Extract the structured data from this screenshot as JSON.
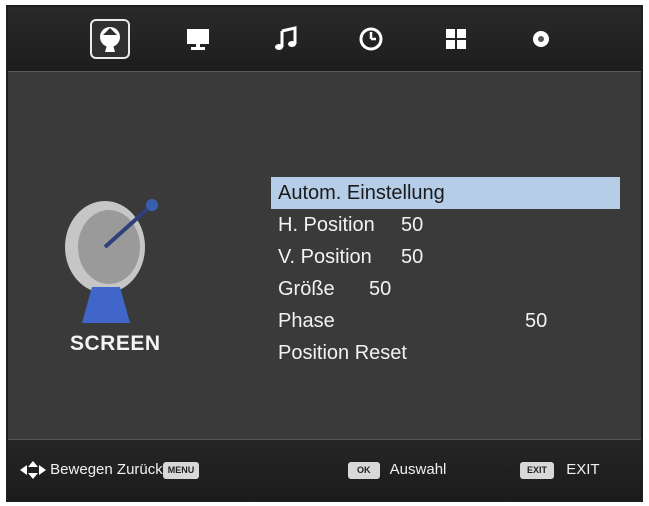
{
  "tabs": [
    {
      "icon": "satellite-icon",
      "active": true
    },
    {
      "icon": "monitor-icon",
      "active": false
    },
    {
      "icon": "music-note-icon",
      "active": false
    },
    {
      "icon": "clock-icon",
      "active": false
    },
    {
      "icon": "grid-icon",
      "active": false
    },
    {
      "icon": "gear-icon",
      "active": false
    }
  ],
  "section": {
    "title": "SCREEN",
    "icon": "satellite-dish-icon"
  },
  "menu": {
    "items": [
      {
        "label": "Autom. Einstellung",
        "value": ""
      },
      {
        "label": "H. Position",
        "value": "50"
      },
      {
        "label": "V. Position",
        "value": "50"
      },
      {
        "label": "Größe",
        "value": "50"
      },
      {
        "label": "Phase",
        "value": "50"
      },
      {
        "label": "Position Reset",
        "value": ""
      }
    ],
    "selected_index": 0
  },
  "footer": {
    "move_label": "Bewegen",
    "back_label": "Zurück",
    "menu_key": "MENU",
    "ok_key": "OK",
    "select_label": "Auswahl",
    "exit_key": "EXIT",
    "exit_label": "EXIT"
  },
  "colors": {
    "highlight": "#b6cde8",
    "background": "#3a3a3a",
    "bar": "#1f1f1f"
  }
}
